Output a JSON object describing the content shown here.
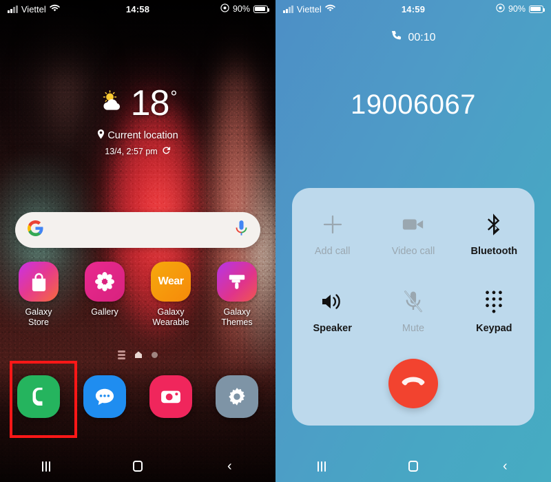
{
  "left_screen": {
    "name": "home-screen",
    "status_bar": {
      "carrier": "Viettel",
      "time": "14:58",
      "battery_percent": "90%",
      "icons": [
        "signal-bars-icon",
        "wifi-icon",
        "alarm-icon",
        "battery-icon"
      ]
    },
    "weather_widget": {
      "temperature": "18",
      "degree_symbol": "°",
      "location": "Current location",
      "updated": "13/4, 2:57 pm",
      "weather_icon": "partly-cloudy-sun-icon",
      "location_icon": "map-pin-icon",
      "refresh_icon": "refresh-icon"
    },
    "search_bar": {
      "logo": "google-g-icon",
      "mic": "microphone-icon",
      "placeholder": ""
    },
    "apps": [
      {
        "label": "Galaxy\nStore",
        "label_line1": "Galaxy",
        "label_line2": "Store",
        "icon": "shopping-bag-icon"
      },
      {
        "label": "Gallery",
        "label_line1": "Gallery",
        "label_line2": "",
        "icon": "flower-icon"
      },
      {
        "label": "Galaxy\nWearable",
        "label_line1": "Galaxy",
        "label_line2": "Wearable",
        "icon": "wear-text-icon"
      },
      {
        "label": "Galaxy\nThemes",
        "label_line1": "Galaxy",
        "label_line2": "Themes",
        "icon": "paint-roller-icon"
      }
    ],
    "page_indicators": {
      "count": 3,
      "active_index": 1
    },
    "dock": [
      {
        "label": "Phone",
        "icon": "phone-handset-icon",
        "highlighted": true
      },
      {
        "label": "Messages",
        "icon": "message-bubble-icon",
        "highlighted": false
      },
      {
        "label": "Camera",
        "icon": "camera-icon",
        "highlighted": false
      },
      {
        "label": "Settings",
        "icon": "gear-icon",
        "highlighted": false
      }
    ],
    "nav_bar": {
      "recents": "recents-icon",
      "home": "home-icon",
      "back": "back-icon"
    }
  },
  "right_screen": {
    "name": "in-call-screen",
    "status_bar": {
      "carrier": "Viettel",
      "time": "14:59",
      "battery_percent": "90%",
      "icons": [
        "signal-bars-icon",
        "wifi-icon",
        "alarm-icon",
        "battery-icon"
      ]
    },
    "call": {
      "duration": "00:10",
      "duration_icon": "phone-handset-icon",
      "number": "19006067"
    },
    "options": [
      {
        "label": "Add call",
        "icon": "plus-icon",
        "enabled": false
      },
      {
        "label": "Video call",
        "icon": "video-camera-icon",
        "enabled": false
      },
      {
        "label": "Bluetooth",
        "icon": "bluetooth-icon",
        "enabled": true
      },
      {
        "label": "Speaker",
        "icon": "speaker-icon",
        "enabled": true
      },
      {
        "label": "Mute",
        "icon": "mic-muted-icon",
        "enabled": false
      },
      {
        "label": "Keypad",
        "icon": "dialpad-icon",
        "enabled": true
      }
    ],
    "end_call": {
      "label": "End call",
      "icon": "end-call-icon"
    },
    "nav_bar": {
      "recents": "recents-icon",
      "home": "home-icon",
      "back": "back-icon"
    }
  },
  "colors": {
    "highlight_box": "#ff1717",
    "end_call_button": "#f2432f",
    "call_bg_start": "#4d8fc6",
    "call_bg_end": "#46acc2",
    "options_card": "#bdd9ec",
    "phone_icon": "#25b45e",
    "message_icon": "#1f8df0",
    "camera_icon": "#f0265c",
    "settings_icon": "#7e94a6"
  }
}
